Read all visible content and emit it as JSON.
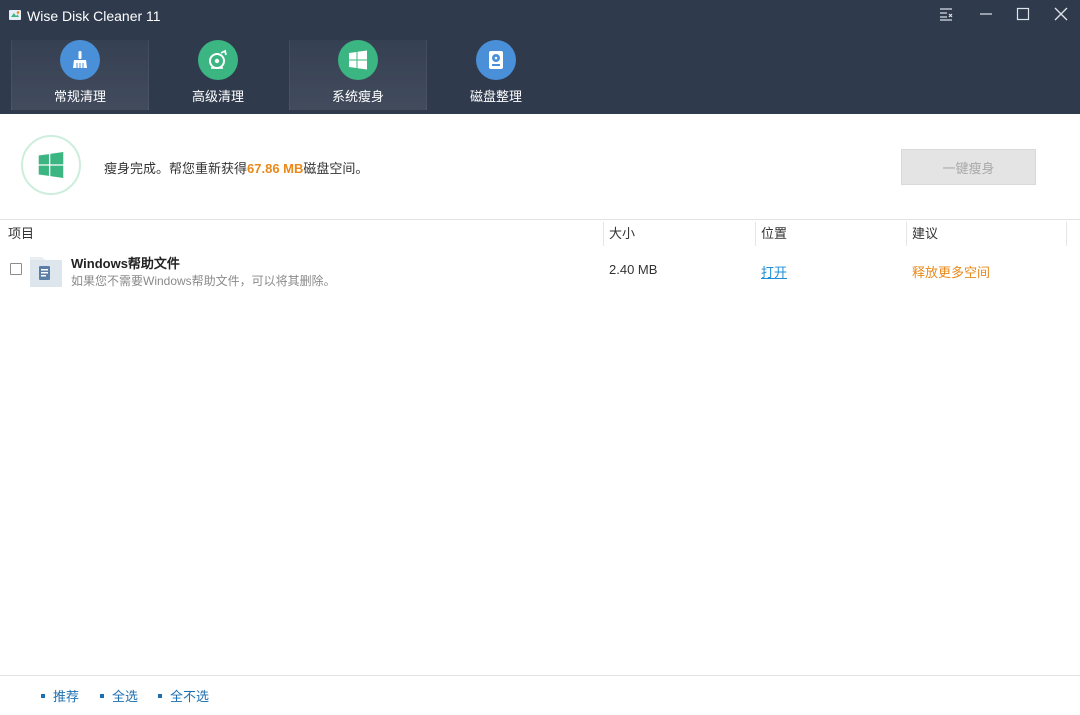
{
  "window": {
    "title": "Wise Disk Cleaner 11",
    "icons": [
      "menu-icon",
      "minimize-icon",
      "maximize-icon",
      "close-icon"
    ]
  },
  "toolbar": {
    "tabs": [
      {
        "label": "常规清理",
        "icon": "broom-icon",
        "color": "#4a90d9"
      },
      {
        "label": "高级清理",
        "icon": "disk-scan-icon",
        "color": "#3bb581"
      },
      {
        "label": "系统瘦身",
        "icon": "windows-icon",
        "color": "#3bb581",
        "active": true
      },
      {
        "label": "磁盘整理",
        "icon": "defrag-icon",
        "color": "#4a90d9"
      }
    ]
  },
  "summary": {
    "prefix": "瘦身完成。帮您重新获得",
    "amount": "67.86 MB",
    "suffix": "磁盘空间。",
    "button_label": "一键瘦身"
  },
  "table": {
    "headers": [
      "项目",
      "大小",
      "位置",
      "建议"
    ],
    "rows": [
      {
        "title": "Windows帮助文件",
        "description": "如果您不需要Windows帮助文件，可以将其删除。",
        "size": "2.40 MB",
        "location": "打开",
        "advice": "释放更多空间",
        "checked": false
      }
    ]
  },
  "footer": {
    "links": [
      "推荐",
      "全选",
      "全不选"
    ]
  },
  "colors": {
    "header_bg": "#2f3a4d",
    "accent_orange": "#e8891a",
    "link_blue": "#1d8ed8",
    "green": "#3bb581",
    "blue": "#4a90d9"
  }
}
